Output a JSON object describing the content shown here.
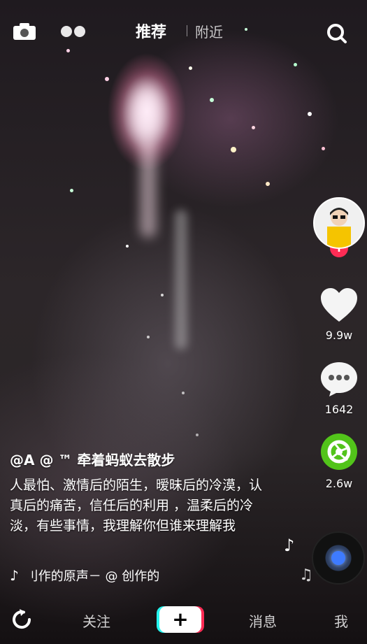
{
  "topbar": {
    "tab_recommend": "推荐",
    "tab_nearby": "附近",
    "icons": [
      "camera-icon",
      "dots-icon",
      "search-icon"
    ]
  },
  "side": {
    "likes": "9.9w",
    "comments": "1642",
    "shares": "2.6w"
  },
  "post": {
    "author": "@A @ ™ 牵着蚂蚁去散步",
    "caption": "人最怕、激情后的陌生，暧昧后的冷漠，认真后的痛苦，信任后的利用 ，温柔后的冷淡，有些事情，我理解你但谁来理解我",
    "music": "刂作的原声－   @  创作的"
  },
  "bottombar": {
    "follow": "关注",
    "messages": "消息",
    "me": "我"
  },
  "colors": {
    "accent_red": "#fe2c55",
    "share_green": "#52c41a",
    "tiktok_cyan": "#25f4ee"
  }
}
